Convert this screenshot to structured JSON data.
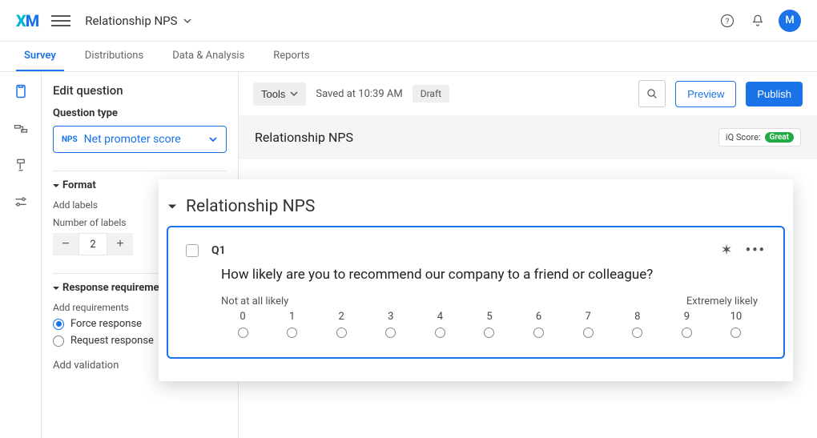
{
  "header": {
    "project_name": "Relationship NPS",
    "avatar_initial": "M"
  },
  "tabs": [
    "Survey",
    "Distributions",
    "Data & Analysis",
    "Reports"
  ],
  "active_tab": 0,
  "edit_panel": {
    "title": "Edit question",
    "question_type_label": "Question type",
    "question_type_badge": "NPS",
    "question_type_name": "Net promoter score",
    "format_section": "Format",
    "add_labels": "Add labels",
    "number_of_labels_label": "Number of labels",
    "number_of_labels_value": "2",
    "response_section": "Response requirements",
    "add_requirements": "Add requirements",
    "force_response": "Force response",
    "request_response": "Request response",
    "add_validation": "Add validation"
  },
  "canvas_toolbar": {
    "tools": "Tools",
    "saved": "Saved at 10:39 AM",
    "draft": "Draft",
    "preview": "Preview",
    "publish": "Publish"
  },
  "survey_block": {
    "title": "Relationship NPS",
    "iq_label": "iQ Score:",
    "iq_value": "Great"
  },
  "overlay": {
    "title": "Relationship NPS",
    "q_number": "Q1",
    "q_text": "How likely are you to recommend our company to a friend or colleague?",
    "left_label": "Not at all likely",
    "right_label": "Extremely likely",
    "scale": [
      "0",
      "1",
      "2",
      "3",
      "4",
      "5",
      "6",
      "7",
      "8",
      "9",
      "10"
    ]
  }
}
